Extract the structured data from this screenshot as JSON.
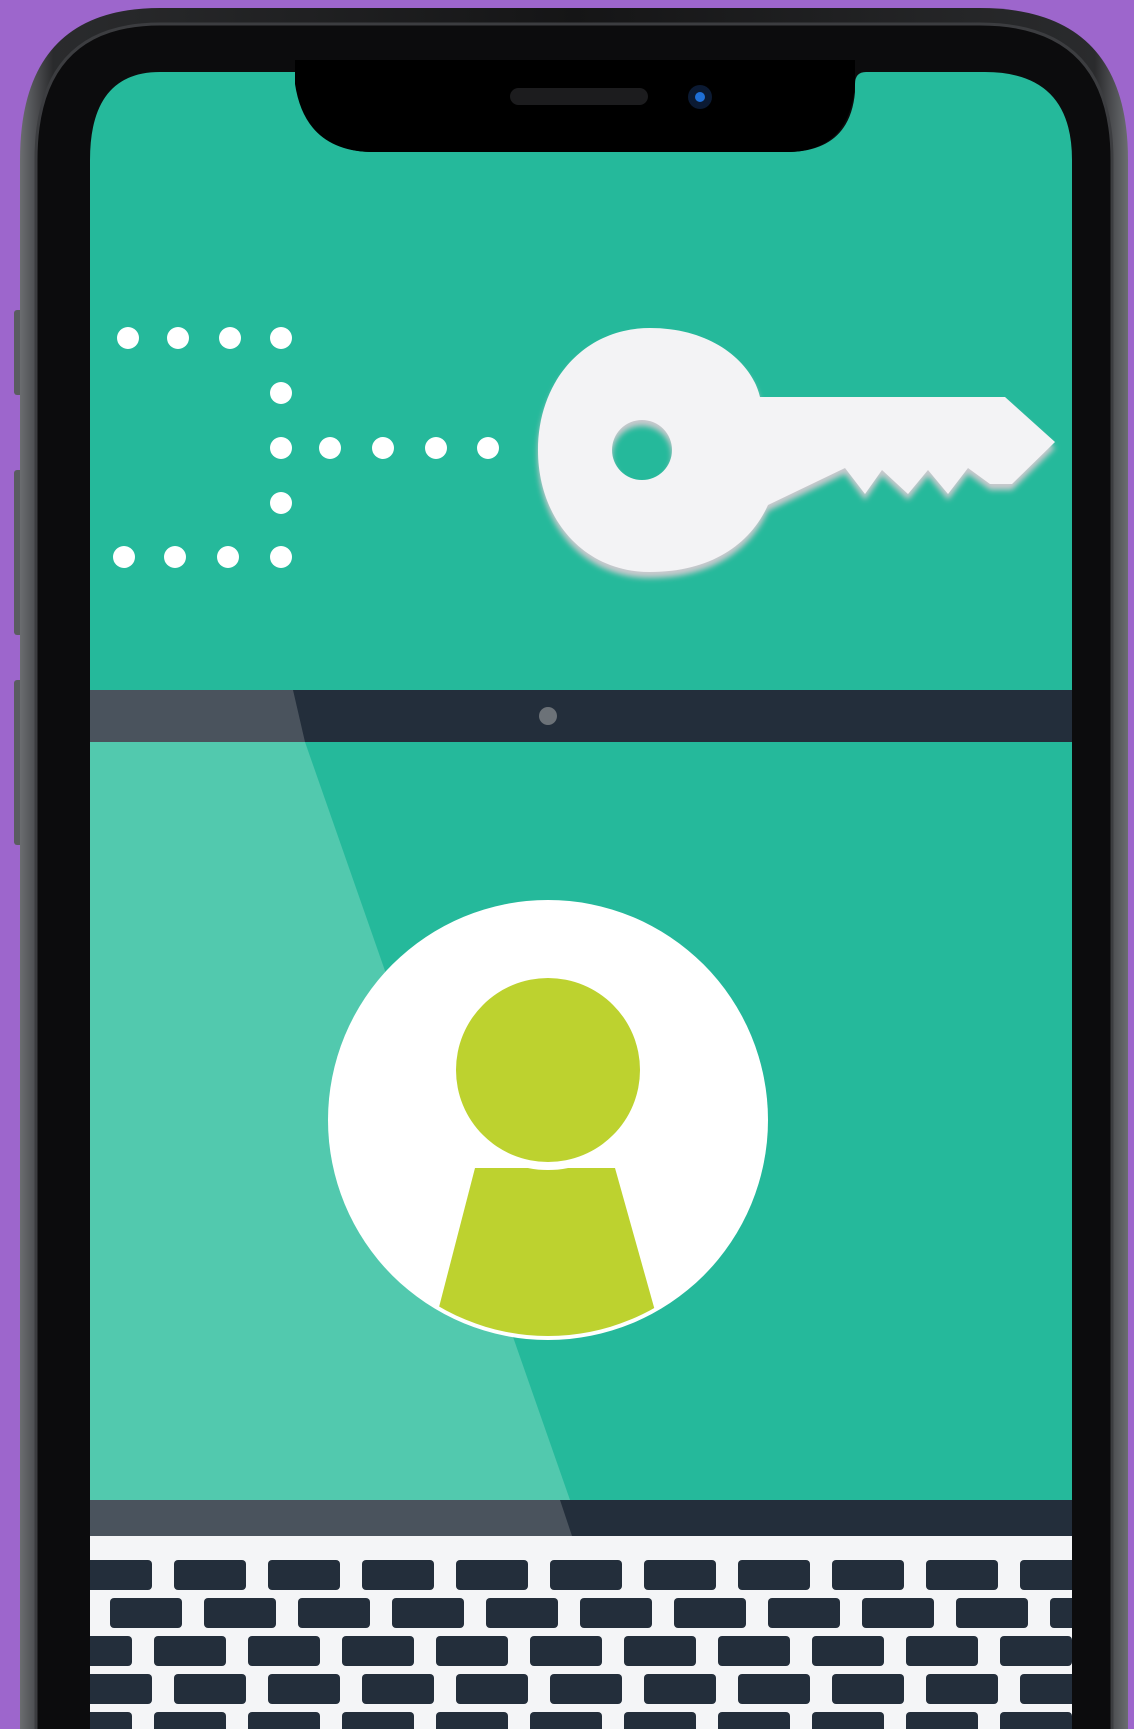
{
  "colors": {
    "background": "#9d66cc",
    "phone_frame": "#1b1b1c",
    "screen": "#25b99b",
    "screen_highlight": "#52c9ae",
    "laptop_dark": "#232e3b",
    "laptop_bezel_gray": "#4a535d",
    "key_fill": "#f3f3f5",
    "dots": "#ffffff",
    "keyhole": "#bdd22f",
    "keyboard_deck": "#f4f5f7",
    "keycap": "#232e3b"
  },
  "icons": {
    "key": "key-icon",
    "keyhole": "keyhole-icon",
    "dotted_path": "dotted-line-icon",
    "camera": "camera-icon",
    "speaker": "earpiece-icon",
    "webcam": "webcam-icon",
    "keyboard": "keyboard-icon"
  }
}
